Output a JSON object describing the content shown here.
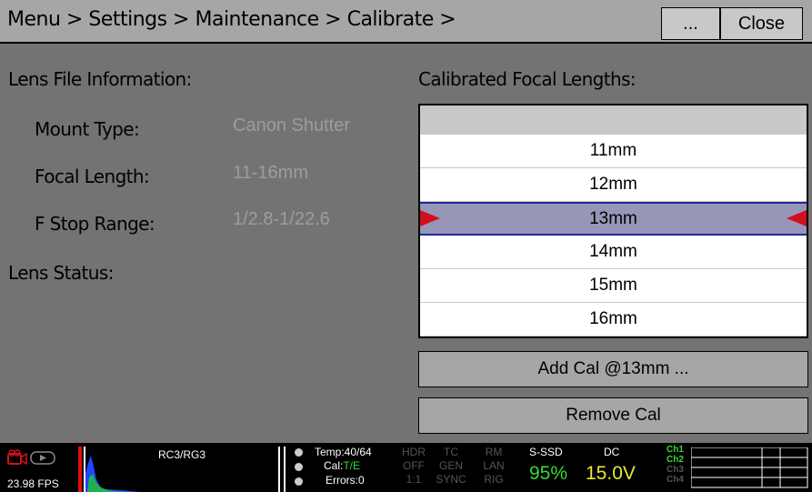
{
  "header": {
    "breadcrumb": "Menu > Settings > Maintenance > Calibrate >",
    "more_label": "...",
    "close_label": "Close"
  },
  "lens_info": {
    "title": "Lens File Information:",
    "mount_type_label": "Mount Type:",
    "mount_type_value": "Canon Shutter",
    "focal_length_label": "Focal Length:",
    "focal_length_value": "11-16mm",
    "fstop_label": "F Stop Range:",
    "fstop_value": "1/2.8-1/22.6",
    "status_label": "Lens Status:"
  },
  "focal_list": {
    "title": "Calibrated Focal Lengths:",
    "items": [
      "11mm",
      "12mm",
      "13mm",
      "14mm",
      "15mm",
      "16mm"
    ],
    "selected": "13mm"
  },
  "actions": {
    "add_cal": "Add Cal @13mm ...",
    "remove_cal": "Remove Cal"
  },
  "status_bar": {
    "fps": "23.98 FPS",
    "color_space": "RC3/RG3",
    "temp": "Temp:40/64",
    "cal_label": "Cal:",
    "cal_value": "T/E",
    "errors": "Errors:0",
    "hdr": "HDR",
    "hdr_value": "OFF",
    "hdr_ratio": "1:1",
    "tc": "TC",
    "tc_gen": "GEN",
    "tc_sync": "SYNC",
    "rm": "RM",
    "rm_lan": "LAN",
    "rm_rig": "RIG",
    "media": "S-SSD",
    "media_value": "95%",
    "power": "DC",
    "power_value": "15.0V",
    "channels": [
      "Ch1",
      "Ch2",
      "Ch3",
      "Ch4"
    ],
    "accent_green": "#33dd33",
    "accent_yellow": "#e8e830"
  }
}
